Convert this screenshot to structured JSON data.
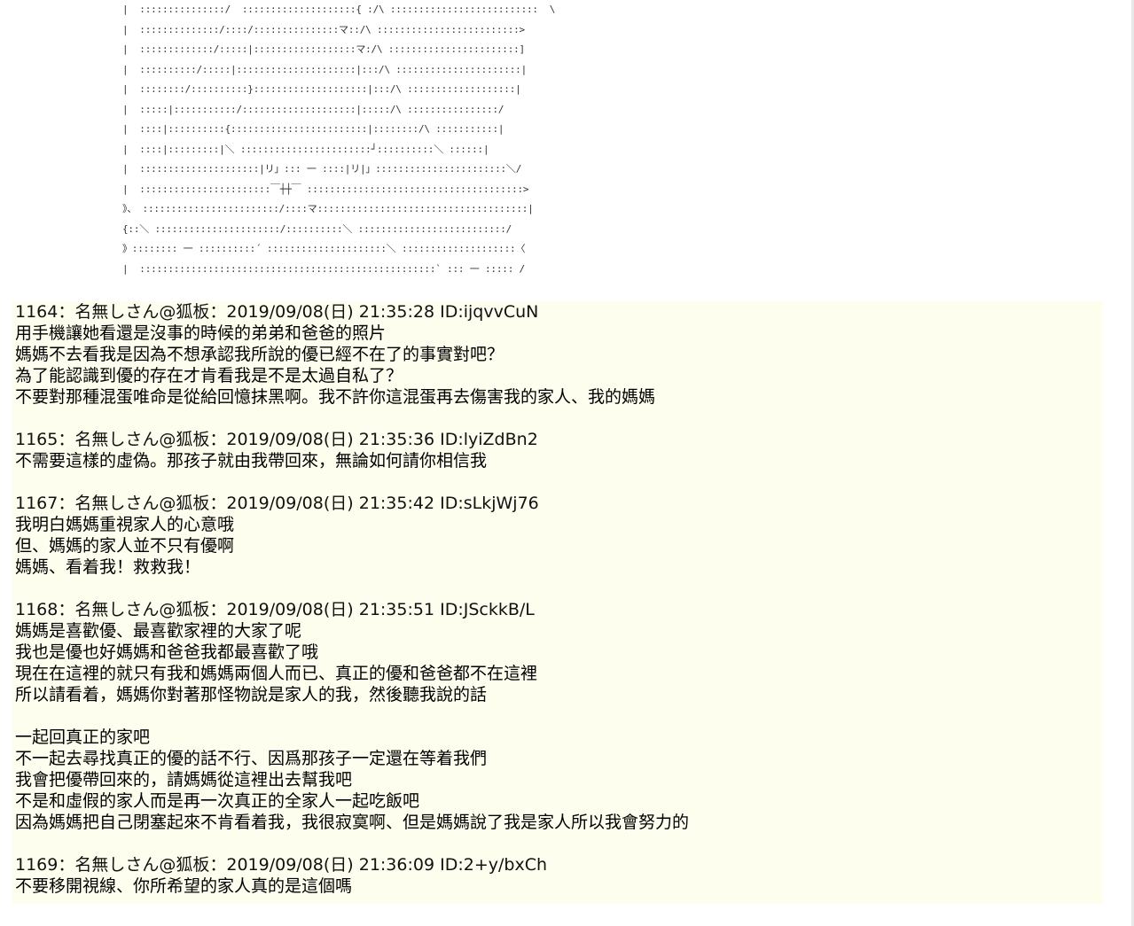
{
  "ascii_art": [
    "|  :::::::::::::::/  ::::::::::::::::::::{ :/\\ ::::::::::::::::::::::::::  \\",
    "|  ::::::::::::::/::::/:::::::::::::::マ::/\\ :::::::::::::::::::::::::>",
    "|  :::::::::::::/:::::|::::::::::::::::::マ:/\\ :::::::::::::::::::::::]",
    "|  ::::::::::/:::::|:::::::::::::::::::::|:::/\\ ::::::::::::::::::::::|",
    "|  ::::::::/::::::::::}::::::::::::::::::::|:::/\\ :::::::::::::::::::|",
    "|  :::::|:::::::::::/::::::::::::::::::::|:::::/\\ ::::::::::::::::/",
    "|  ::::|::::::::::{::::::::::::::::::::::::|::::::::/\\ :::::::::::|",
    "|  ::::|:::::::::|＼ :::::::::::::::::::::::┘::::::::::＼ ::::::|",
    "|  :::::::::::::::::::::|リ」::: 一 ::::|リ|」:::::::::::::::::::::::＼/",
    "|  :::::::::::::::::::::::￣┼┼￣ ::::::::::::::::::::::::::::::::::::::>",
    "》、 ::::::::::::::::::::::::/::::マ:::::::::::::::::::::::::::::::::::::|",
    "{::＼ ::::::::::::::::::::::/::::::::::＼ ::::::::::::::::::::::::::/",
    "》:::::::: 一 ::::::::::´ :::::::::::::::::::::＼ ::::::::::::::::::::〈",
    "|  ::::::::::::::::::::::::::::::::::::::::::::::::::::` ::: 一 ::::: /"
  ],
  "posts": [
    {
      "header": "1164：名無しさん@狐板：2019/09/08(日) 21:35:28 ID:ijqvvCuN",
      "lines": [
        "用手機讓她看還是沒事的時候的弟弟和爸爸的照片",
        "媽媽不去看我是因為不想承認我所說的優已經不在了的事實對吧？",
        "為了能認識到優的存在才肯看我是不是太過自私了？",
        "不要對那種混蛋唯命是從給回憶抹黑啊。我不許你這混蛋再去傷害我的家人、我的媽媽"
      ]
    },
    {
      "header": "1165：名無しさん@狐板：2019/09/08(日) 21:35:36 ID:lyiZdBn2",
      "lines": [
        "不需要這樣的虛偽。那孩子就由我帶回來，無論如何請你相信我"
      ]
    },
    {
      "header": "1167：名無しさん@狐板：2019/09/08(日) 21:35:42 ID:sLkjWj76",
      "lines": [
        "我明白媽媽重視家人的心意哦",
        "但、媽媽的家人並不只有優啊",
        "媽媽、看着我！救救我！"
      ]
    },
    {
      "header": "1168：名無しさん@狐板：2019/09/08(日) 21:35:51 ID:JSckkB/L",
      "lines": [
        "媽媽是喜歡優、最喜歡家裡的大家了呢",
        "我也是優也好媽媽和爸爸我都最喜歡了哦",
        "現在在這裡的就只有我和媽媽兩個人而已、真正的優和爸爸都不在這裡",
        "所以請看着，媽媽你對著那怪物說是家人的我，然後聽我說的話",
        "",
        "一起回真正的家吧",
        "不一起去尋找真正的優的話不行、因爲那孩子一定還在等着我們",
        "我會把優帶回來的，請媽媽從這裡出去幫我吧",
        "不是和虛假的家人而是再一次真正的全家人一起吃飯吧",
        "因為媽媽把自己閉塞起來不肯看着我，我很寂寞啊、但是媽媽說了我是家人所以我會努力的"
      ]
    },
    {
      "header": "1169：名無しさん@狐板：2019/09/08(日) 21:36:09 ID:2+y/bxCh",
      "lines": [
        "不要移開視線、你所希望的家人真的是這個嗎"
      ]
    }
  ]
}
